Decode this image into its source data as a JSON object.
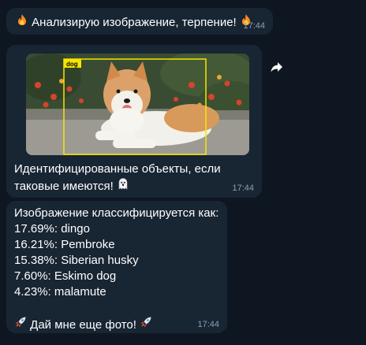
{
  "messages": {
    "m1": {
      "text": "Анализирую изображение, терпение!",
      "time": "17:44"
    },
    "m2": {
      "caption_line1": "Идентифицированные объекты, если",
      "caption_line2": "таковые имеются!",
      "box_label": "dog",
      "time": "17:44"
    },
    "m3": {
      "header": "Изображение классифицируется как:",
      "results": [
        "17.69%: dingo",
        "16.21%: Pembroke",
        "15.38%: Siberian husky",
        "7.60%: Eskimo dog",
        "4.23%: malamute"
      ],
      "footer": "Дай мне еще фото!",
      "time": "17:44"
    }
  },
  "colors": {
    "background": "#0e1621",
    "bubble": "#182533",
    "detection_box": "#f5e500",
    "timestamp": "#8aa0b5"
  },
  "icons": [
    "fire-icon",
    "ghost-icon",
    "rocket-icon",
    "share-arrow-icon"
  ]
}
